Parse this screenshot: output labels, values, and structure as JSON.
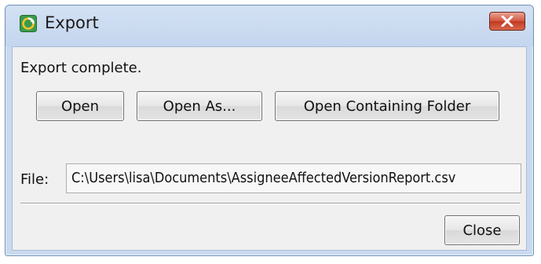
{
  "window": {
    "title": "Export",
    "icon": "export-app-icon",
    "close_icon": "close-icon"
  },
  "status_text": "Export complete.",
  "buttons": {
    "open": "Open",
    "open_as": "Open As...",
    "open_folder": "Open Containing Folder",
    "close": "Close"
  },
  "file": {
    "label": "File:",
    "value": "C:\\Users\\lisa\\Documents\\AssigneeAffectedVersionReport.csv"
  },
  "colors": {
    "titlebar": "#c9daf0",
    "close_button": "#c8432a",
    "dialog_body": "#f0f0f0"
  }
}
